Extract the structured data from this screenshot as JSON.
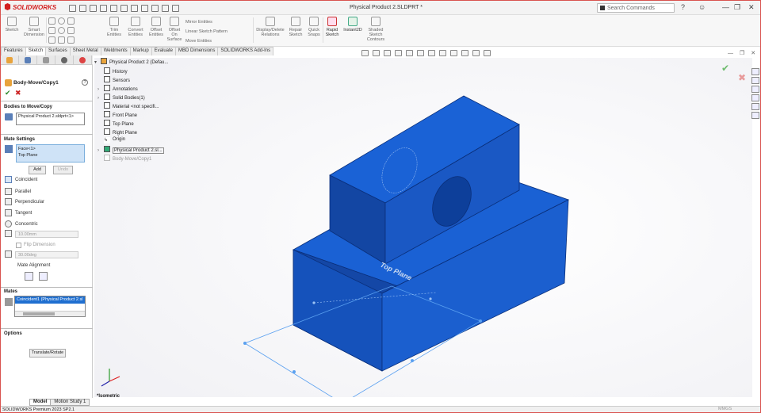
{
  "app": {
    "name": "SOLIDWORKS",
    "window_title": "Physical Product 2.SLDPRT *",
    "search_placeholder": "Search Commands"
  },
  "ribbon": {
    "buttons": [
      "Sketch",
      "Smart Dimension",
      "Trim Entities",
      "Convert Entities",
      "Offset Entities",
      "Offset On Surface",
      "Mirror Entities",
      "Linear Sketch Pattern",
      "Move Entities",
      "Display/Delete Relations",
      "Repair Sketch",
      "Quick Snaps",
      "Rapid Sketch",
      "Instant2D",
      "Shaded Sketch Contours"
    ]
  },
  "tabs": [
    "Features",
    "Sketch",
    "Surfaces",
    "Sheet Metal",
    "Weldments",
    "Markup",
    "Evaluate",
    "MBD Dimensions",
    "SOLIDWORKS Add-Ins"
  ],
  "active_tab": "Sketch",
  "property_manager": {
    "title": "Body-Move/Copy1",
    "help": "?",
    "ok_symbol": "✔",
    "cancel_symbol": "✖",
    "bodies_section": "Bodies to Move/Copy",
    "body_value": "Physical Product 2.sldprt<1>",
    "mate_settings": "Mate Settings",
    "mate_entities": [
      "Face<1>",
      "Top Plane"
    ],
    "add_label": "Add",
    "undo_label": "Undo",
    "mate_types": [
      "Coincident",
      "Parallel",
      "Perpendicular",
      "Tangent",
      "Concentric"
    ],
    "distance_value": "10.00mm",
    "flip_label": "Flip Dimension",
    "angle_value": "30.00deg",
    "alignment_label": "Mate Alignment",
    "mates_section": "Mates",
    "mate_item": "Coincident1 (Physical Product 2.sl",
    "options_section": "Options",
    "translate_label": "Translate/Rotate"
  },
  "tree": {
    "root": "Physical Product 2 (Defau...",
    "items": [
      "History",
      "Sensors",
      "Annotations",
      "Solid Bodies(1)",
      "Material <not specifi...",
      "Front Plane",
      "Top Plane",
      "Right Plane",
      "Origin",
      "Physical Product 2.sl...",
      "Body-Move/Copy1"
    ]
  },
  "viewport": {
    "plane_label": "Top Plane",
    "view_name": "*Isometric",
    "body_color": "#1558c7",
    "edge_color": "#0a2f7a"
  },
  "bottom_tabs": [
    "Model",
    "Motion Study 1"
  ],
  "status": {
    "text": "SOLIDWORKS Premium 2023 SP2.1",
    "units": "MMGS"
  }
}
